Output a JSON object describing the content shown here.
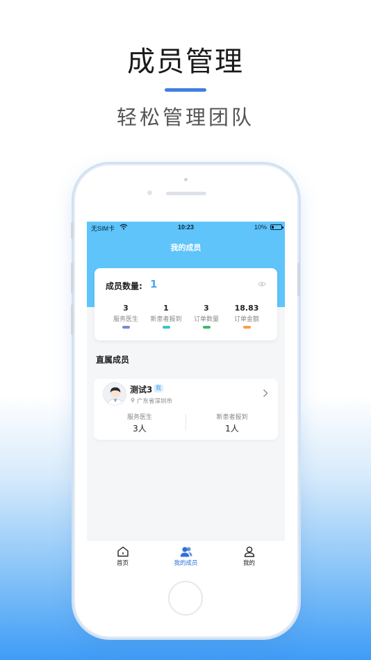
{
  "promo": {
    "title": "成员管理",
    "subtitle": "轻松管理团队"
  },
  "status_bar": {
    "carrier": "无SIM卡",
    "time": "10:23",
    "battery": "10%"
  },
  "screen": {
    "nav_title": "我的成员",
    "member_count_label": "成员数量:",
    "member_count_value": "1",
    "stats": [
      {
        "value": "3",
        "label": "服务医生",
        "color": "#7b86d6"
      },
      {
        "value": "1",
        "label": "新患者报到",
        "color": "#35c6c2"
      },
      {
        "value": "3",
        "label": "订单数量",
        "color": "#3fb86b"
      },
      {
        "value": "18.83",
        "label": "订单金额",
        "color": "#f5a04a"
      }
    ],
    "section_title": "直属成员",
    "member": {
      "name": "测试3",
      "badge": "我",
      "location": "广东省深圳市",
      "stats": [
        {
          "label": "服务医生",
          "value": "3人"
        },
        {
          "label": "新患者报到",
          "value": "1人"
        }
      ]
    }
  },
  "tabbar": {
    "items": [
      {
        "label": "首页",
        "icon": "home-icon",
        "active": false
      },
      {
        "label": "我的成员",
        "icon": "members-icon",
        "active": true
      },
      {
        "label": "我的",
        "icon": "profile-icon",
        "active": false
      }
    ]
  },
  "colors": {
    "header": "#5ec4fa",
    "accent": "#3f7fe0",
    "count_value": "#4aa9f0"
  }
}
